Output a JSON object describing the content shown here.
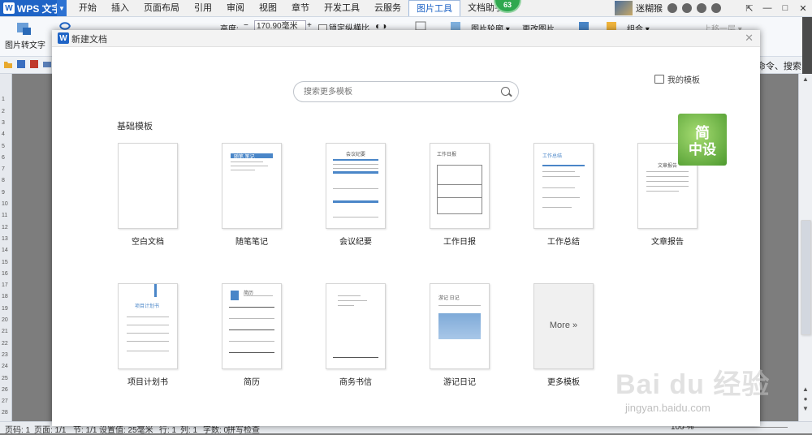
{
  "app": {
    "name": "WPS 文字",
    "logo": "W"
  },
  "tabs": [
    {
      "label": "开始",
      "active": false
    },
    {
      "label": "插入",
      "active": false
    },
    {
      "label": "页面布局",
      "active": false
    },
    {
      "label": "引用",
      "active": false
    },
    {
      "label": "审阅",
      "active": false
    },
    {
      "label": "视图",
      "active": false
    },
    {
      "label": "章节",
      "active": false
    },
    {
      "label": "开发工具",
      "active": false
    },
    {
      "label": "云服务",
      "active": false
    },
    {
      "label": "图片工具",
      "active": true
    },
    {
      "label": "文档助手",
      "active": false
    }
  ],
  "badge_count": "63",
  "user": {
    "name": "迷糊猴"
  },
  "ribbon": {
    "pic_to_text": "图片转文字",
    "height_label": "高度:",
    "height_value": "170.90毫米",
    "lock_ratio": "锁定纵横比",
    "pic_outline": "图片轮廓",
    "change_pic": "更改图片",
    "group": "组合",
    "bring_up": "上移一层"
  },
  "quickbar": {
    "search_hint": "命令、搜索..."
  },
  "dialog": {
    "title": "新建文档",
    "search_placeholder": "搜索更多模板",
    "my_templates": "我的模板",
    "section_title": "基础模板",
    "templates": [
      {
        "label": "空白文档"
      },
      {
        "label": "随笔笔记"
      },
      {
        "label": "会议纪要"
      },
      {
        "label": "工作日报"
      },
      {
        "label": "工作总结"
      },
      {
        "label": "文章报告"
      },
      {
        "label": "项目计划书"
      },
      {
        "label": "简历"
      },
      {
        "label": "商务书信"
      },
      {
        "label": "游记日记"
      },
      {
        "label": "更多模板"
      }
    ],
    "more_button": "More »",
    "thumb_text": {
      "suibi": "随笔 笔记",
      "huiyi": "会议纪要",
      "ribao": "工作日报",
      "zongjie": "工作总结",
      "baogao": "文章报告",
      "xiangmu": "项目计划书",
      "jianli": "简历",
      "youji": "游记 日记"
    }
  },
  "overlay_logo": {
    "line1": "简",
    "line2": "中设"
  },
  "watermark": {
    "brand": "Bai du 经验",
    "url": "jingyan.baidu.com"
  },
  "status": {
    "page": "页码: 1",
    "pages": "页面: 1/1",
    "section": "节: 1/1",
    "setting": "设置值: 25毫米",
    "row": "行: 1",
    "col": "列: 1",
    "words": "字数: 0",
    "spell": "拼写检查",
    "zoom": "100 %"
  },
  "colors": {
    "accent": "#1f64c6",
    "badge": "#2fa84f",
    "template_blue": "#4a86c8"
  }
}
